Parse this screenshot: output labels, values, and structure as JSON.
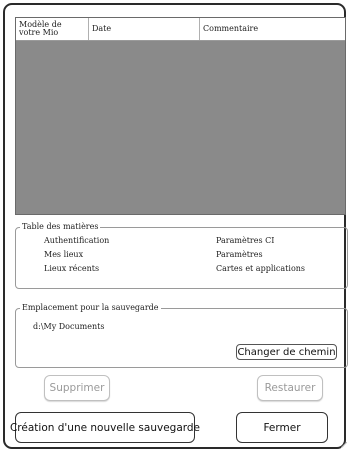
{
  "backup_list": {
    "columns": [
      "Modèle de votre Mio",
      "Date",
      "Commentaire"
    ],
    "rows": []
  },
  "toc": {
    "legend": "Table des matières",
    "left_items": [
      "Authentification",
      "Mes lieux",
      "Lieux récents"
    ],
    "right_items": [
      "Paramètres CI",
      "Paramètres",
      "Cartes et applications"
    ]
  },
  "save_location": {
    "legend": "Emplacement pour la sauvegarde",
    "path": "d:\\My Documents",
    "change_path_label": "Changer de chemin"
  },
  "buttons": {
    "delete_label": "Supprimer",
    "restore_label": "Restaurer",
    "new_backup_label": "Création d'une nouvelle sauvegarde",
    "close_label": "Fermer"
  },
  "colors": {
    "list_background": "#8a8a8a",
    "disabled_text": "#9a9a9a"
  }
}
